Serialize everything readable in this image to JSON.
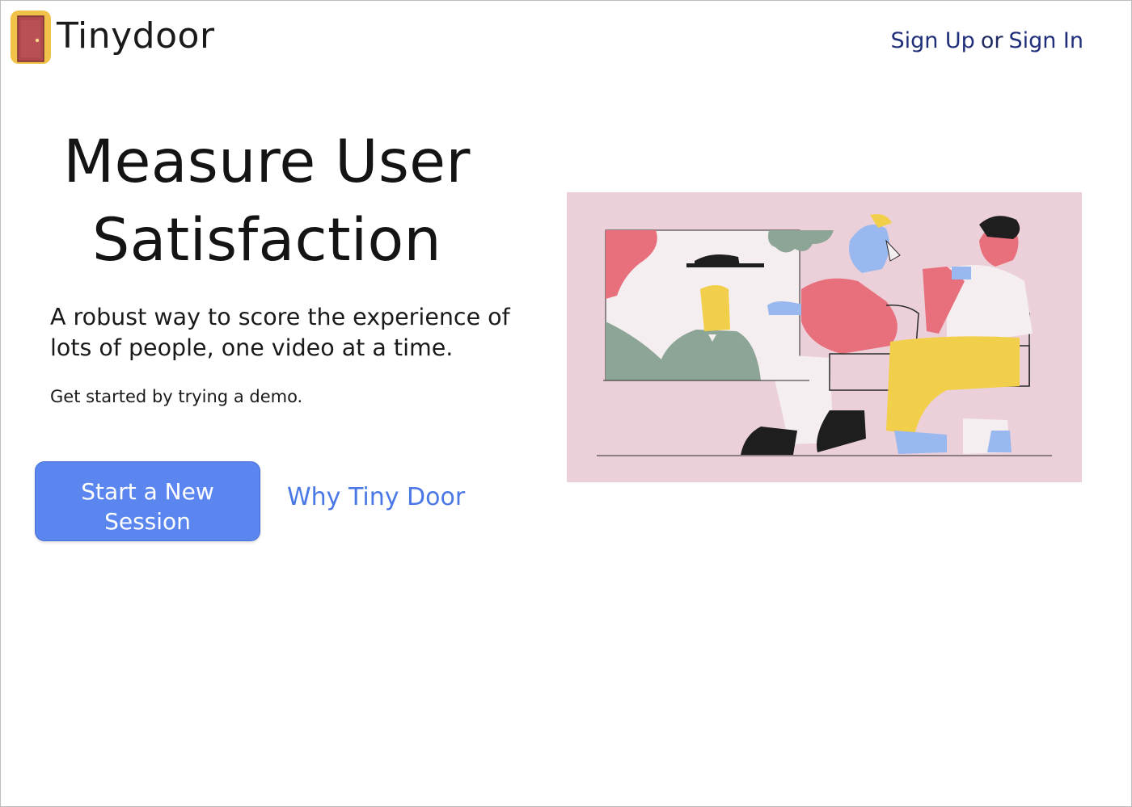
{
  "header": {
    "brand": "Tinydoor",
    "logo_icon": "door-icon",
    "sign_up_label": "Sign Up",
    "or_label": "or",
    "sign_in_label": "Sign In"
  },
  "hero": {
    "title_line1": "Measure User",
    "title_line2": "Satisfaction",
    "subtitle_line1": "A robust way to score the experience of",
    "subtitle_line2": "lots of people, one video at a time.",
    "cta_text": "Get started by trying a demo.",
    "start_button_line1": "Start a New",
    "start_button_line2": "Session",
    "why_link": "Why Tiny Door"
  },
  "illustration": {
    "subject": "people-sitting-illustration"
  },
  "colors": {
    "primary_button": "#5b86ef",
    "link": "#4a78e6",
    "auth_link": "#1f2f7a",
    "illustration_bg": "#ecd0d9",
    "logo_gold": "#f0c24a",
    "logo_door": "#b0494e"
  }
}
